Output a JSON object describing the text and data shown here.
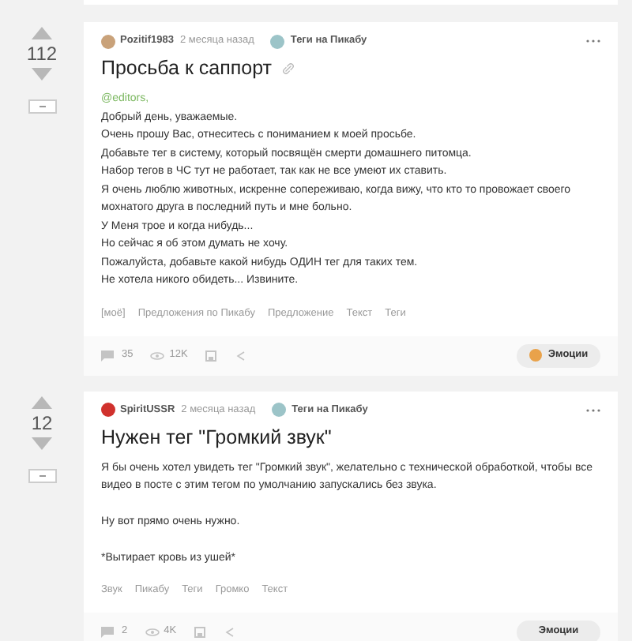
{
  "posts": [
    {
      "votes": "112",
      "author": "Pozitif1983",
      "time": "2 месяца назад",
      "community": "Теги на Пикабу",
      "color": "#c9a27a",
      "title": "Просьба к саппорт",
      "show_link_icon": true,
      "body": [
        {
          "kind": "mention",
          "text": "@editors,"
        },
        {
          "kind": "line",
          "text": "Добрый день, уважаемые."
        },
        {
          "kind": "line",
          "text": "Очень прошу Вас, отнеситесь с пониманием к моей просьбе."
        },
        {
          "kind": "line",
          "text": "Добавьте тег в систему, который посвящён смерти домашнего питомца."
        },
        {
          "kind": "line",
          "text": "Набор тегов в ЧС тут не работает, так как не все умеют их ставить."
        },
        {
          "kind": "line",
          "text": "Я очень люблю животных, искренне сопереживаю, когда вижу, что кто то провожает своего мохнатого друга в последний путь и мне больно."
        },
        {
          "kind": "line",
          "text": "У Меня трое и когда нибудь..."
        },
        {
          "kind": "line",
          "text": "Но сейчас я об этом думать не хочу."
        },
        {
          "kind": "line",
          "text": "Пожалуйста, добавьте какой нибудь ОДИН тег для таких тем."
        },
        {
          "kind": "line",
          "text": "Не хотела никого обидеть... Извините."
        }
      ],
      "tags": [
        "[моё]",
        "Предложения по Пикабу",
        "Предложение",
        "Текст",
        "Теги"
      ],
      "comments": "35",
      "views": "12K",
      "emotions": "Эмоции",
      "show_emoji": true
    },
    {
      "votes": "12",
      "author": "SpiritUSSR",
      "time": "2 месяца назад",
      "community": "Теги на Пикабу",
      "color": "#d0312d",
      "title": "Нужен тег \"Громкий звук\"",
      "show_link_icon": false,
      "body": [
        {
          "kind": "para",
          "text": "Я бы очень хотел увидеть тег \"Громкий звук\", желательно с технической обработкой, чтобы все видео в посте с этим тегом по умолчанию запускались без звука."
        },
        {
          "kind": "para",
          "text": "Ну вот прямо очень нужно."
        },
        {
          "kind": "para",
          "text": "*Вытирает кровь из ушей*"
        }
      ],
      "tags": [
        "Звук",
        "Пикабу",
        "Теги",
        "Громко",
        "Текст"
      ],
      "comments": "2",
      "views": "4K",
      "emotions": "Эмоции",
      "show_emoji": false
    }
  ]
}
